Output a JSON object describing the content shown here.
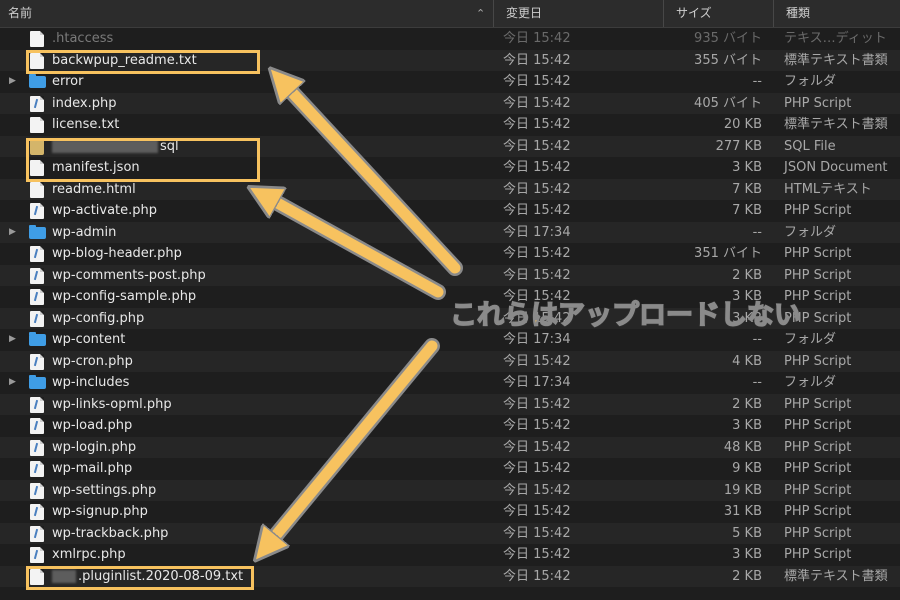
{
  "columns": {
    "name": "名前",
    "date": "変更日",
    "size": "サイズ",
    "kind": "種類"
  },
  "sort_icon": "chevron-up-icon",
  "rows": [
    {
      "name": ".htaccess",
      "date": "今日 15:42",
      "size": "935 バイト",
      "kind": "テキス…ディット",
      "icon": "file-icon"
    },
    {
      "name": "backwpup_readme.txt",
      "date": "今日 15:42",
      "size": "355 バイト",
      "kind": "標準テキスト書類",
      "icon": "file-icon"
    },
    {
      "name": "error",
      "date": "今日 15:42",
      "size": "--",
      "kind": "フォルダ",
      "icon": "folder-icon"
    },
    {
      "name": "index.php",
      "date": "今日 15:42",
      "size": "405 バイト",
      "kind": "PHP Script",
      "icon": "php-file-icon"
    },
    {
      "name": "license.txt",
      "date": "今日 15:42",
      "size": "20 KB",
      "kind": "標準テキスト書類",
      "icon": "file-icon"
    },
    {
      "name": "sql",
      "date": "今日 15:42",
      "size": "277 KB",
      "kind": "SQL File",
      "icon": "sql-file-icon"
    },
    {
      "name": "manifest.json",
      "date": "今日 15:42",
      "size": "3 KB",
      "kind": "JSON Document",
      "icon": "file-icon"
    },
    {
      "name": "readme.html",
      "date": "今日 15:42",
      "size": "7 KB",
      "kind": "HTMLテキスト",
      "icon": "file-icon"
    },
    {
      "name": "wp-activate.php",
      "date": "今日 15:42",
      "size": "7 KB",
      "kind": "PHP Script",
      "icon": "php-file-icon"
    },
    {
      "name": "wp-admin",
      "date": "今日 17:34",
      "size": "--",
      "kind": "フォルダ",
      "icon": "folder-icon"
    },
    {
      "name": "wp-blog-header.php",
      "date": "今日 15:42",
      "size": "351 バイト",
      "kind": "PHP Script",
      "icon": "php-file-icon"
    },
    {
      "name": "wp-comments-post.php",
      "date": "今日 15:42",
      "size": "2 KB",
      "kind": "PHP Script",
      "icon": "php-file-icon"
    },
    {
      "name": "wp-config-sample.php",
      "date": "今日 15:42",
      "size": "3 KB",
      "kind": "PHP Script",
      "icon": "php-file-icon"
    },
    {
      "name": "wp-config.php",
      "date": "今日 15:42",
      "size": "3 KB",
      "kind": "PHP Script",
      "icon": "php-file-icon"
    },
    {
      "name": "wp-content",
      "date": "今日 17:34",
      "size": "--",
      "kind": "フォルダ",
      "icon": "folder-icon"
    },
    {
      "name": "wp-cron.php",
      "date": "今日 15:42",
      "size": "4 KB",
      "kind": "PHP Script",
      "icon": "php-file-icon"
    },
    {
      "name": "wp-includes",
      "date": "今日 17:34",
      "size": "--",
      "kind": "フォルダ",
      "icon": "folder-icon"
    },
    {
      "name": "wp-links-opml.php",
      "date": "今日 15:42",
      "size": "2 KB",
      "kind": "PHP Script",
      "icon": "php-file-icon"
    },
    {
      "name": "wp-load.php",
      "date": "今日 15:42",
      "size": "3 KB",
      "kind": "PHP Script",
      "icon": "php-file-icon"
    },
    {
      "name": "wp-login.php",
      "date": "今日 15:42",
      "size": "48 KB",
      "kind": "PHP Script",
      "icon": "php-file-icon"
    },
    {
      "name": "wp-mail.php",
      "date": "今日 15:42",
      "size": "9 KB",
      "kind": "PHP Script",
      "icon": "php-file-icon"
    },
    {
      "name": "wp-settings.php",
      "date": "今日 15:42",
      "size": "19 KB",
      "kind": "PHP Script",
      "icon": "php-file-icon"
    },
    {
      "name": "wp-signup.php",
      "date": "今日 15:42",
      "size": "31 KB",
      "kind": "PHP Script",
      "icon": "php-file-icon"
    },
    {
      "name": "wp-trackback.php",
      "date": "今日 15:42",
      "size": "5 KB",
      "kind": "PHP Script",
      "icon": "php-file-icon"
    },
    {
      "name": "xmlrpc.php",
      "date": "今日 15:42",
      "size": "3 KB",
      "kind": "PHP Script",
      "icon": "php-file-icon"
    },
    {
      "name": ".pluginlist.2020-08-09.txt",
      "date": "今日 15:42",
      "size": "2 KB",
      "kind": "標準テキスト書類",
      "icon": "file-icon"
    }
  ],
  "annotation": {
    "text": "これらはアップロードしない",
    "color": "#f7c25f"
  },
  "colors": {
    "background": "#1e1e1e",
    "header": "#2c2c2c",
    "folder": "#3f9de6",
    "highlight": "#f7c25f"
  }
}
